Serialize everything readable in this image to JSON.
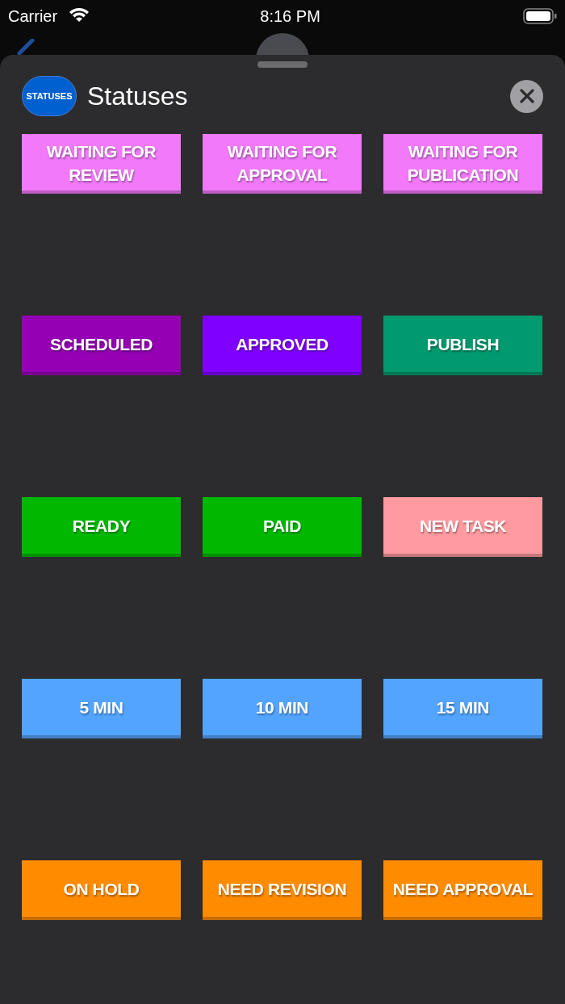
{
  "status_bar": {
    "carrier": "Carrier",
    "time": "8:16 PM"
  },
  "sheet": {
    "badge": "STATUSES",
    "title": "Statuses"
  },
  "statuses": [
    {
      "label": "WAITING FOR REVIEW",
      "color": "#f179fa"
    },
    {
      "label": "WAITING FOR APPROVAL",
      "color": "#f179fa"
    },
    {
      "label": "WAITING FOR PUBLICATION",
      "color": "#f179fa"
    },
    {
      "label": "SCHEDULED",
      "color": "#9500b5"
    },
    {
      "label": "APPROVED",
      "color": "#7f00ff"
    },
    {
      "label": "PUBLISH",
      "color": "#009a6e"
    },
    {
      "label": "READY",
      "color": "#00b800"
    },
    {
      "label": "PAID",
      "color": "#00b800"
    },
    {
      "label": "NEW TASK",
      "color": "#ff9aa0"
    },
    {
      "label": "5 MIN",
      "color": "#53a4ff"
    },
    {
      "label": "10 MIN",
      "color": "#53a4ff"
    },
    {
      "label": "15 MIN",
      "color": "#53a4ff"
    },
    {
      "label": "ON HOLD",
      "color": "#ff8c00"
    },
    {
      "label": "NEED REVISION",
      "color": "#ff8c00"
    },
    {
      "label": "NEED APPROVAL",
      "color": "#ff8c00"
    }
  ]
}
